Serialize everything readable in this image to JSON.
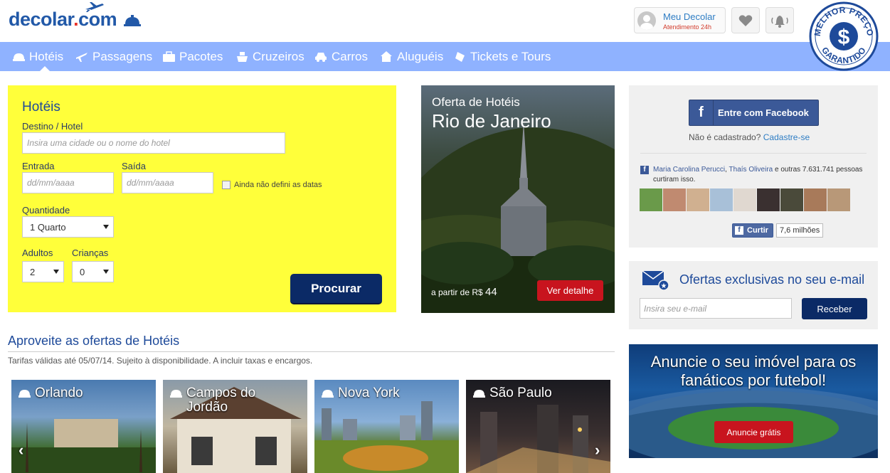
{
  "header": {
    "logo_text": "decolar",
    "logo_dot": ".",
    "logo_com": "com",
    "account_name": "Meu Decolar",
    "account_sub": "Atendimento 24h",
    "seal_top": "MELHOR PREÇO",
    "seal_bottom": "GARANTIDO"
  },
  "nav": [
    {
      "label": "Hotéis",
      "icon": "hotel-bell-icon",
      "active": true
    },
    {
      "label": "Passagens",
      "icon": "plane-icon"
    },
    {
      "label": "Pacotes",
      "icon": "suitcase-icon"
    },
    {
      "label": "Cruzeiros",
      "icon": "cruise-ship-icon"
    },
    {
      "label": "Carros",
      "icon": "car-icon"
    },
    {
      "label": "Aluguéis",
      "icon": "house-icon"
    },
    {
      "label": "Tickets e Tours",
      "icon": "ticket-icon"
    }
  ],
  "search": {
    "title": "Hotéis",
    "destino_label": "Destino / Hotel",
    "destino_placeholder": "Insira uma cidade ou o nome do hotel",
    "entrada_label": "Entrada",
    "saida_label": "Saída",
    "date_placeholder": "dd/mm/aaaa",
    "no_dates_label": "Ainda não defini as datas",
    "quantidade_label": "Quantidade",
    "quantidade_value": "1 Quarto",
    "adultos_label": "Adultos",
    "adultos_value": "2",
    "criancas_label": "Crianças",
    "criancas_value": "0",
    "submit_label": "Procurar"
  },
  "offer": {
    "line1": "Oferta de Hotéis",
    "city": "Rio de Janeiro",
    "price_prefix": "a partir de R$",
    "price_value": "44",
    "button_label": "Ver detalhe"
  },
  "deals": {
    "title": "Aproveite as ofertas de Hotéis",
    "subtitle": "Tarifas válidas até 05/07/14. Sujeito à disponibilidade. A incluir taxas e encargos.",
    "tiles": [
      {
        "label": "Orlando"
      },
      {
        "label": "Campos do Jordão"
      },
      {
        "label": "Nova York"
      },
      {
        "label": "São Paulo"
      }
    ],
    "prev": "‹",
    "next": "›"
  },
  "facebook": {
    "button_label": "Entre com Facebook",
    "question": "Não é cadastrado?",
    "signup_link": "Cadastre-se",
    "friend1": "Maria Carolina Perucci",
    "friend_sep": ", ",
    "friend2": "Thaís Oliveira",
    "likes_rest": " e outras 7.631.741 pessoas curtiram isso.",
    "like_button": "Curtir",
    "like_count": "7,6 milhões"
  },
  "newsletter": {
    "title": "Ofertas exclusivas no seu e-mail",
    "placeholder": "Insira seu e-mail",
    "button_label": "Receber"
  },
  "ad": {
    "headline": "Anuncie o seu imóvel para os fanáticos por futebol!",
    "button_label": "Anuncie grátis"
  },
  "colors": {
    "brand_blue": "#2259a8",
    "nav_bg": "#8fb2ff",
    "search_bg": "#ffff3a",
    "dark_button": "#0b2a66",
    "red_button": "#c8141e"
  }
}
